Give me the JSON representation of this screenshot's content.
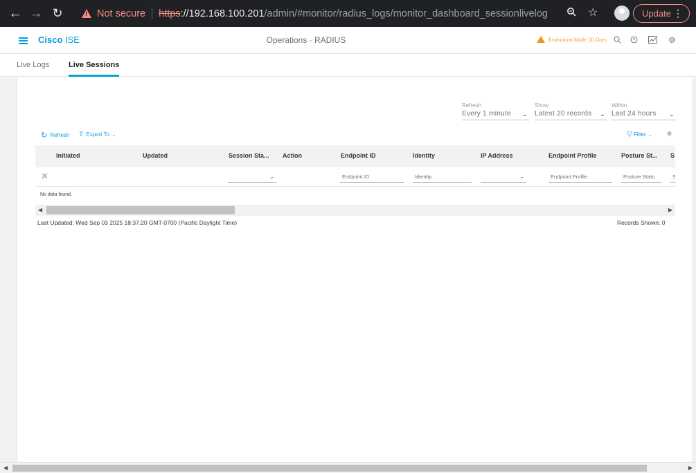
{
  "browser": {
    "not_secure": "Not secure",
    "url_scheme": "https",
    "url_host": "://192.168.100.201",
    "url_path": "/admin/#monitor/radius_logs/monitor_dashboard_sessionlivelog",
    "update_label": "Update"
  },
  "header": {
    "brand_bold": "Cisco",
    "brand_rest": " ISE",
    "breadcrumb": "Operations · RADIUS",
    "eval_text": "Evaluation Mode 50 Days"
  },
  "tabs": [
    {
      "label": "Live Logs",
      "active": false
    },
    {
      "label": "Live Sessions",
      "active": true
    }
  ],
  "controls": {
    "refresh_label": "Refresh",
    "refresh_value": "Every 1 minute",
    "show_label": "Show",
    "show_value": "Latest 20 records",
    "within_label": "Within",
    "within_value": "Last 24 hours"
  },
  "toolbar": {
    "refresh": "Refresh",
    "export": "Export To",
    "filter": "Filter"
  },
  "table": {
    "columns": [
      "Initiated",
      "Updated",
      "Session Sta...",
      "Action",
      "Endpoint ID",
      "Identity",
      "IP Address",
      "Endpoint Profile",
      "Posture St...",
      "S"
    ],
    "filters": {
      "endpoint_id": "Endpoint ID",
      "identity": "Identity",
      "endpoint_profile": "Endpoint Profile",
      "posture": "Posture Statu",
      "last": "S"
    },
    "empty_text": "No data found."
  },
  "footer": {
    "last_updated": "Last Updated: Wed Sep 03 2025 18:37:20 GMT-0700 (Pacific Daylight Time)",
    "records_shown": "Records Shown: 0"
  }
}
